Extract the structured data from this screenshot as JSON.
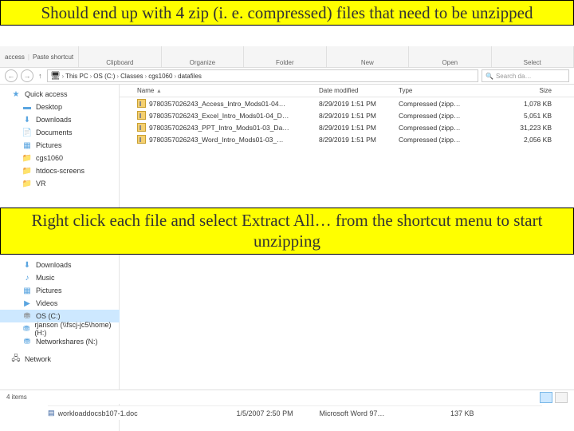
{
  "callouts": {
    "top": "Should end up with 4 zip (i. e. compressed) files that need to be unzipped",
    "mid": "Right click each file and select Extract All… from the shortcut menu to start unzipping"
  },
  "ribbon": {
    "left_icon_text": "access",
    "paste_label": "Paste shortcut",
    "sections": [
      "Clipboard",
      "Organize",
      "Folder",
      "New",
      "Open",
      "Select"
    ]
  },
  "address": {
    "arrow_back": "←",
    "arrow_fwd": "→",
    "arrow_up": "↑",
    "crumbs": [
      "This PC",
      "OS (C:)",
      "Classes",
      "cgs1060",
      "datafiles"
    ],
    "search_placeholder": "Search da…"
  },
  "nav_top": [
    {
      "label": "Quick access",
      "icon": "star-icon",
      "sub": false
    },
    {
      "label": "Desktop",
      "icon": "pic-icon",
      "sub": true
    },
    {
      "label": "Downloads",
      "icon": "dl-icon",
      "sub": true
    },
    {
      "label": "Documents",
      "icon": "doc-icon",
      "sub": true
    },
    {
      "label": "Pictures",
      "icon": "pic-icon",
      "sub": true
    },
    {
      "label": "cgs1060",
      "icon": "folder-icon",
      "sub": true
    },
    {
      "label": "htdocs-screens",
      "icon": "folder-icon",
      "sub": true
    },
    {
      "label": "VR",
      "icon": "folder-icon",
      "sub": true
    }
  ],
  "nav_bottom": [
    {
      "label": "Downloads",
      "icon": "dl-icon"
    },
    {
      "label": "Music",
      "icon": "pic-icon"
    },
    {
      "label": "Pictures",
      "icon": "pic-icon"
    },
    {
      "label": "Videos",
      "icon": "pic-icon"
    },
    {
      "label": "OS (C:)",
      "icon": "drive-icon",
      "sel": true
    },
    {
      "label": "rjanson (\\\\fscj-jc5\\home) (H:)",
      "icon": "net-icon"
    },
    {
      "label": "Networkshares (N:)",
      "icon": "net-icon"
    },
    {
      "label": "",
      "icon": ""
    },
    {
      "label": "Network",
      "icon": "pc-icon"
    }
  ],
  "columns": {
    "name": "Name",
    "date": "Date modified",
    "type": "Type",
    "size": "Size",
    "sort": "▴"
  },
  "files": [
    {
      "name": "9780357026243_Access_Intro_Mods01-04…",
      "date": "8/29/2019 1:51 PM",
      "type": "Compressed (zipp…",
      "size": "1,078 KB"
    },
    {
      "name": "9780357026243_Excel_Intro_Mods01-04_D…",
      "date": "8/29/2019 1:51 PM",
      "type": "Compressed (zipp…",
      "size": "5,051 KB"
    },
    {
      "name": "9780357026243_PPT_Intro_Mods01-03_Da…",
      "date": "8/29/2019 1:51 PM",
      "type": "Compressed (zipp…",
      "size": "31,223 KB"
    },
    {
      "name": "9780357026243_Word_Intro_Mods01-03_…",
      "date": "8/29/2019 1:51 PM",
      "type": "Compressed (zipp…",
      "size": "2,056 KB"
    }
  ],
  "status": {
    "text": "4 items"
  },
  "bottom_fragment": {
    "name": "workloaddocsb107-1.doc",
    "date": "1/5/2007 2:50 PM",
    "type": "Microsoft Word 97…",
    "size": "137 KB"
  }
}
